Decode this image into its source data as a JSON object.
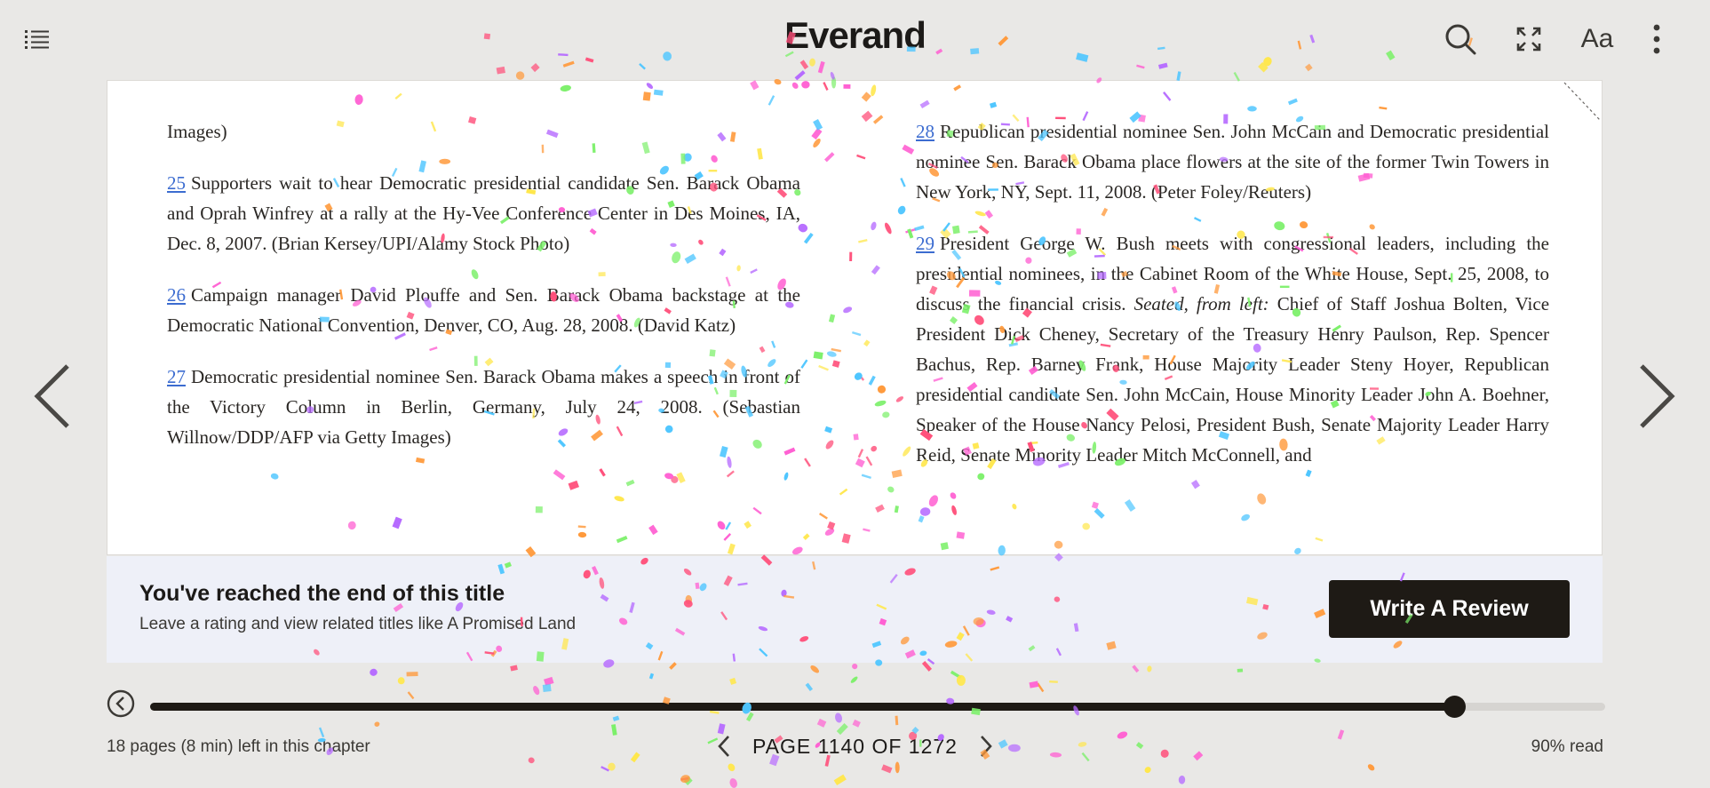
{
  "app": {
    "logo": "Everand"
  },
  "toolbar": {
    "toc_icon": "list-icon",
    "search_icon": "search-icon",
    "fullscreen_icon": "expand-icon",
    "font_label": "Aa",
    "more_icon": "more-vertical-icon"
  },
  "navigation": {
    "prev_icon": "chevron-left-icon",
    "next_icon": "chevron-right-icon"
  },
  "page": {
    "left_column": [
      {
        "fn": "",
        "text": "Images)"
      },
      {
        "fn": "25",
        "text": "Supporters wait to hear Democratic presidential candidate Sen. Barack Obama and Oprah Winfrey at a rally at the Hy-Vee Conference Center in Des Moines, IA, Dec. 8, 2007. (Brian Kersey/UPI/Alamy Stock Photo)"
      },
      {
        "fn": "26",
        "text": "Campaign manager David Plouffe and Sen. Barack Obama backstage at the Democratic National Convention, Denver, CO, Aug. 28, 2008. (David Katz)"
      },
      {
        "fn": "27",
        "text": "Democratic presidential nominee Sen. Barack Obama makes a speech in front of the Victory Column in Berlin, Germany, July 24, 2008. (Sebastian Willnow/DDP/AFP via Getty Images)"
      }
    ],
    "right_column": {
      "p28_fn": "28",
      "p28_text": "Republican presidential nominee Sen. John McCain and Democratic presidential nominee Sen. Barack Obama place flowers at the site of the former Twin Towers in New York, NY, Sept. 11, 2008. (Peter Foley/Reuters)",
      "p29_fn": "29",
      "p29_text_a": "President George W. Bush meets with congressional leaders, including the presidential nominees, in the Cabinet Room of the White House, Sept. 25, 2008, to discuss the financial crisis.",
      "p29_italic": "Seated, from left:",
      "p29_text_b": "Chief of Staff Joshua Bolten, Vice President Dick Cheney, Secretary of the Treasury Henry Paulson, Rep. Spencer Bachus, Rep. Barney Frank, House Majority Leader Steny Hoyer, Republican presidential candidate Sen. John McCain, House Minority Leader John A. Boehner, Speaker of the House Nancy Pelosi, President Bush, Senate Majority Leader Harry Reid, Senate Minority Leader Mitch McConnell, and"
    }
  },
  "end_banner": {
    "title": "You've reached the end of this title",
    "subtitle": "Leave a rating and view related titles like A Promised Land",
    "review_button": "Write A Review"
  },
  "footer": {
    "back_icon": "back-circle-icon",
    "chapter_remaining": "18 pages (8 min) left in this chapter",
    "page_label": "PAGE 1140 OF 1272",
    "percent_read": "90% read",
    "progress_fraction": 0.896
  },
  "colors": {
    "background": "#e9e8e6",
    "page": "#ffffff",
    "banner": "#eef0f8",
    "accent_dark": "#1e1a15",
    "footnote_link": "#3c6cd0",
    "confetti": [
      "#ff5fd2",
      "#ffe74c",
      "#7cf06a",
      "#4fc6ff",
      "#b66bff",
      "#ff9a3c",
      "#ff4f7a"
    ]
  }
}
